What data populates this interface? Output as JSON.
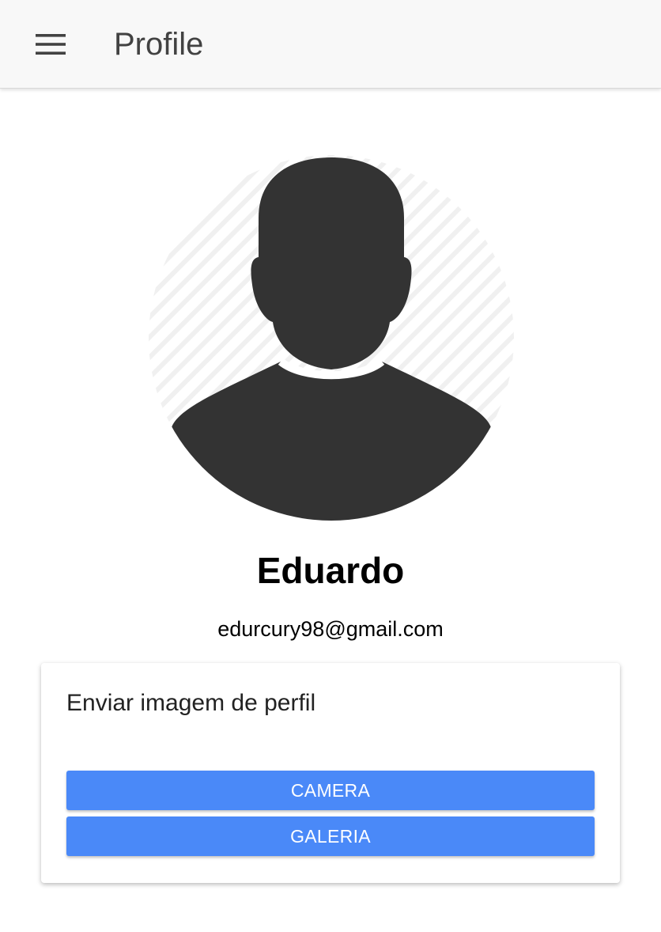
{
  "header": {
    "title": "Profile",
    "menu_icon": "hamburger-menu-icon"
  },
  "profile": {
    "avatar_icon": "person-silhouette-icon",
    "name": "Eduardo",
    "email": "edurcury98@gmail.com"
  },
  "upload_card": {
    "title": "Enviar imagem de perfil",
    "camera_label": "CAMERA",
    "gallery_label": "GALERIA"
  },
  "colors": {
    "primary_button": "#4a89f8",
    "toolbar_bg": "#f8f8f8",
    "silhouette": "#333333"
  }
}
